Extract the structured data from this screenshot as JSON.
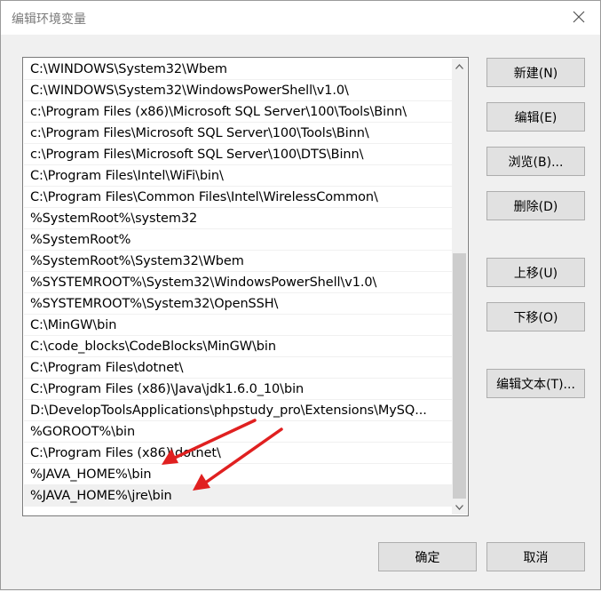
{
  "dialog": {
    "title": "编辑环境变量"
  },
  "path_list": {
    "items": [
      "C:\\WINDOWS\\System32\\Wbem",
      "C:\\WINDOWS\\System32\\WindowsPowerShell\\v1.0\\",
      "c:\\Program Files (x86)\\Microsoft SQL Server\\100\\Tools\\Binn\\",
      "c:\\Program Files\\Microsoft SQL Server\\100\\Tools\\Binn\\",
      "c:\\Program Files\\Microsoft SQL Server\\100\\DTS\\Binn\\",
      "C:\\Program Files\\Intel\\WiFi\\bin\\",
      "C:\\Program Files\\Common Files\\Intel\\WirelessCommon\\",
      "%SystemRoot%\\system32",
      "%SystemRoot%",
      "%SystemRoot%\\System32\\Wbem",
      "%SYSTEMROOT%\\System32\\WindowsPowerShell\\v1.0\\",
      "%SYSTEMROOT%\\System32\\OpenSSH\\",
      "C:\\MinGW\\bin",
      "C:\\code_blocks\\CodeBlocks\\MinGW\\bin",
      "C:\\Program Files\\dotnet\\",
      "C:\\Program Files (x86)\\Java\\jdk1.6.0_10\\bin",
      "D:\\DevelopToolsApplications\\phpstudy_pro\\Extensions\\MySQ...",
      "%GOROOT%\\bin",
      "C:\\Program Files (x86)\\dotnet\\",
      "%JAVA_HOME%\\bin",
      "%JAVA_HOME%\\jre\\bin"
    ],
    "selected_index": 20
  },
  "buttons": {
    "new": "新建(N)",
    "edit": "编辑(E)",
    "browse": "浏览(B)...",
    "delete": "删除(D)",
    "move_up": "上移(U)",
    "move_down": "下移(O)",
    "edit_text": "编辑文本(T)...",
    "ok": "确定",
    "cancel": "取消"
  },
  "colors": {
    "annotation_arrow": "#e02020",
    "scroll_thumb": "#cdcdcd",
    "button_face": "#e1e1e1"
  }
}
